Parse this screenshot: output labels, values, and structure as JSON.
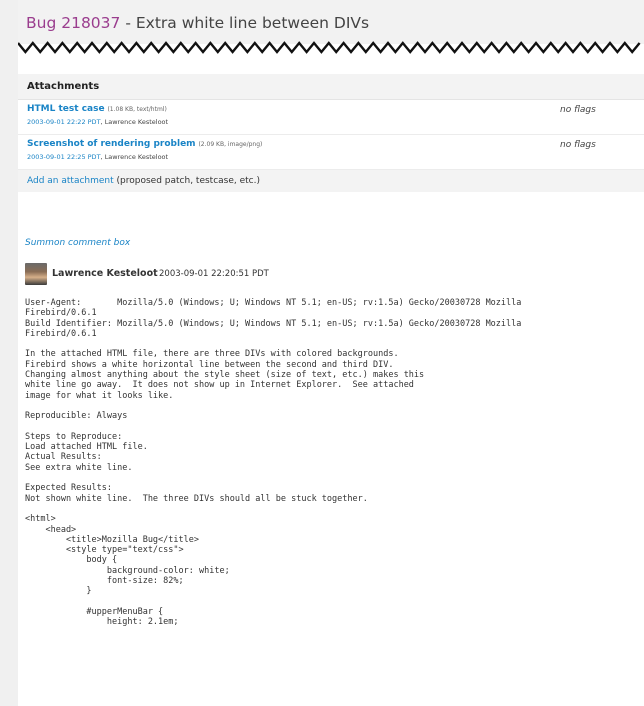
{
  "bug": {
    "number": "Bug 218037",
    "separator": " - ",
    "summary": "Extra white line between DIVs"
  },
  "attachments": {
    "heading": "Attachments",
    "items": [
      {
        "title": "HTML test case",
        "meta": "(1.08 KB, text/html)",
        "date": "2003-09-01 22:22 PDT",
        "author": "Lawrence Kesteloot",
        "flags": "no flags"
      },
      {
        "title": "Screenshot of rendering problem",
        "meta": "(2.09 KB, image/png)",
        "date": "2003-09-01 22:25 PDT",
        "author": "Lawrence Kesteloot",
        "flags": "no flags"
      }
    ],
    "add_link": "Add an attachment",
    "add_note": "(proposed patch, testcase, etc.)"
  },
  "summon_link": "Summon comment box",
  "comment": {
    "author": "Lawrence Kesteloot",
    "time": "2003-09-01 22:20:51 PDT",
    "body": "User-Agent:       Mozilla/5.0 (Windows; U; Windows NT 5.1; en-US; rv:1.5a) Gecko/20030728 Mozilla\nFirebird/0.6.1\nBuild Identifier: Mozilla/5.0 (Windows; U; Windows NT 5.1; en-US; rv:1.5a) Gecko/20030728 Mozilla\nFirebird/0.6.1\n\nIn the attached HTML file, there are three DIVs with colored backgrounds.\nFirebird shows a white horizontal line between the second and third DIV.\nChanging almost anything about the style sheet (size of text, etc.) makes this\nwhite line go away.  It does not show up in Internet Explorer.  See attached\nimage for what it looks like.\n\nReproducible: Always\n\nSteps to Reproduce:\nLoad attached HTML file.\nActual Results:\nSee extra white line.\n\nExpected Results:\nNot shown white line.  The three DIVs should all be stuck together.\n\n<html>\n    <head>\n        <title>Mozilla Bug</title>\n        <style type=\"text/css\">\n            body {\n                background-color: white;\n                font-size: 82%;\n            }\n\n            #upperMenuBar {\n                height: 2.1em;"
  },
  "colors": {
    "bug_number": "#9a3d8e",
    "link": "#1a84c6"
  }
}
